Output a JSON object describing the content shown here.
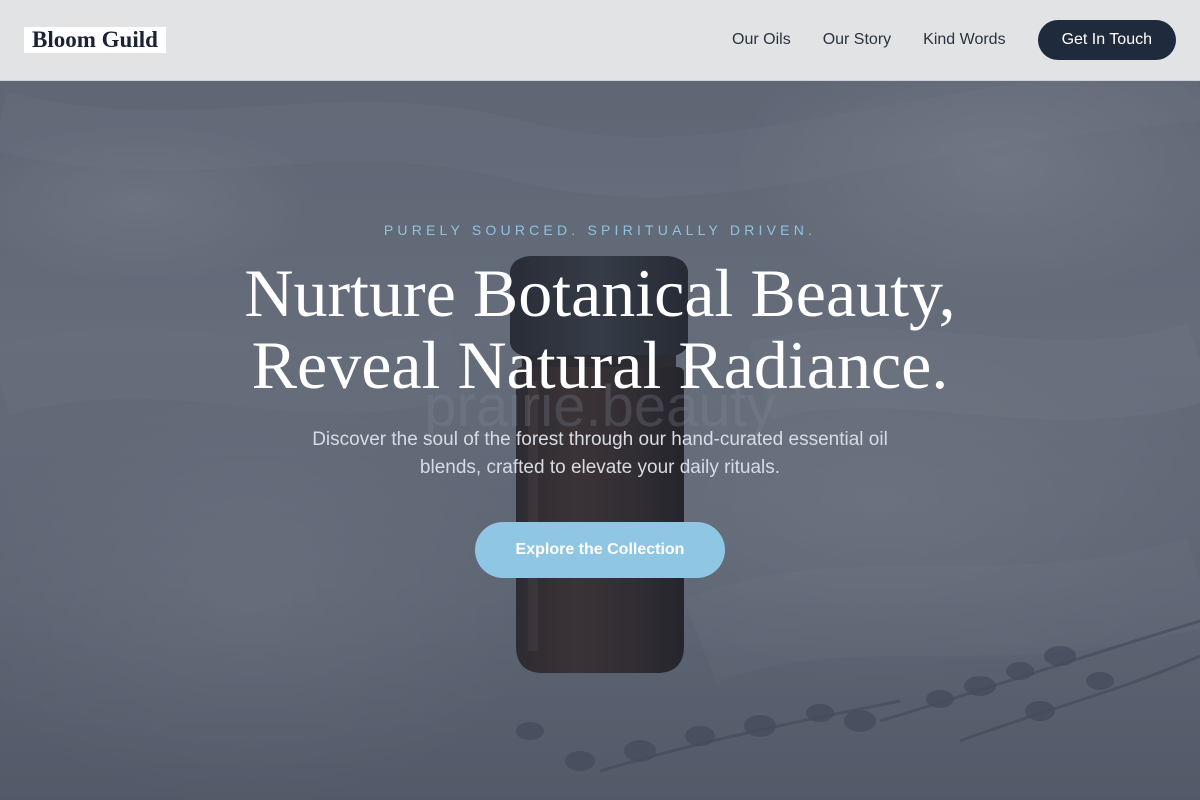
{
  "header": {
    "logo": "Bloom Guild",
    "nav": [
      {
        "label": "Our Oils"
      },
      {
        "label": "Our Story"
      },
      {
        "label": "Kind Words"
      }
    ],
    "cta_label": "Get In Touch"
  },
  "hero": {
    "eyebrow": "PURELY SOURCED. SPIRITUALLY DRIVEN.",
    "headline_line1": "Nurture Botanical Beauty,",
    "headline_line2": "Reveal Natural Radiance.",
    "subtext_line1": "Discover the soul of the forest through our hand-curated essential oil",
    "subtext_line2": "blends, crafted to elevate your daily rituals.",
    "button_label": "Explore the Collection",
    "background_watermark": "prairie.beauty"
  },
  "colors": {
    "header_bg": "#e2e3e5",
    "nav_text": "#2b3340",
    "cta_bg": "#1f2a3c",
    "accent": "#8ec6e4",
    "eyebrow": "#8ec3e0",
    "headline": "#ffffff"
  }
}
